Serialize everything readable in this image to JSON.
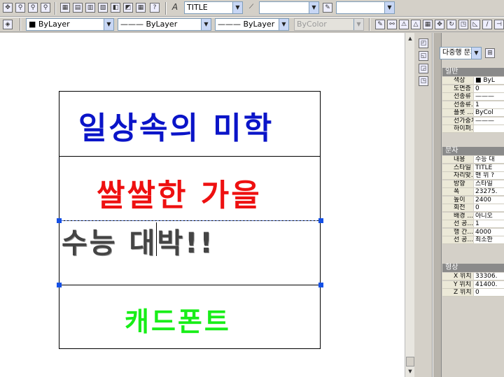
{
  "toolbar1": {
    "text_style": "TITLE",
    "dim_style": "",
    "table_style": ""
  },
  "toolbar2": {
    "color": "ByLayer",
    "linetype": "ByLayer",
    "lineweight": "ByLayer",
    "plotstyle": "ByColor"
  },
  "drawing": {
    "row1": "일상속의 미학",
    "row2": "쌀쌀한 가을",
    "row3": "수능 대박!!",
    "row4": "캐드폰트",
    "colors": {
      "row1": "#0a14c8",
      "row2": "#ee1010",
      "row3": "#444444",
      "row4": "#18ee18"
    }
  },
  "properties": {
    "object_type": "다중행 문자",
    "general": {
      "title": "일반",
      "rows": [
        {
          "key": "색상",
          "value": "■ ByL"
        },
        {
          "key": "도면층",
          "value": "0"
        },
        {
          "key": "선종류",
          "value": "———"
        },
        {
          "key": "선종류...",
          "value": "1"
        },
        {
          "key": "플롯 ...",
          "value": "ByCol"
        },
        {
          "key": "선가중치",
          "value": "———"
        },
        {
          "key": "하이퍼...",
          "value": ""
        }
      ]
    },
    "text": {
      "title": "문자",
      "rows": [
        {
          "key": "내용",
          "value": "수능 대"
        },
        {
          "key": "스타일",
          "value": "TITLE"
        },
        {
          "key": "자리맞...",
          "value": "맨 위 ?"
        },
        {
          "key": "방향",
          "value": "스타일"
        },
        {
          "key": "폭",
          "value": "23275."
        },
        {
          "key": "높이",
          "value": "2400"
        },
        {
          "key": "회전",
          "value": "0"
        },
        {
          "key": "배경 ...",
          "value": "아니오"
        },
        {
          "key": "선 공...",
          "value": "1"
        },
        {
          "key": "행 간...",
          "value": "4000"
        },
        {
          "key": "선 공...",
          "value": "최소한"
        }
      ]
    },
    "geometry": {
      "title": "형상",
      "rows": [
        {
          "key": "X 위치",
          "value": "33306."
        },
        {
          "key": "Y 위치",
          "value": "41400."
        },
        {
          "key": "Z 위치",
          "value": "0"
        }
      ]
    }
  }
}
